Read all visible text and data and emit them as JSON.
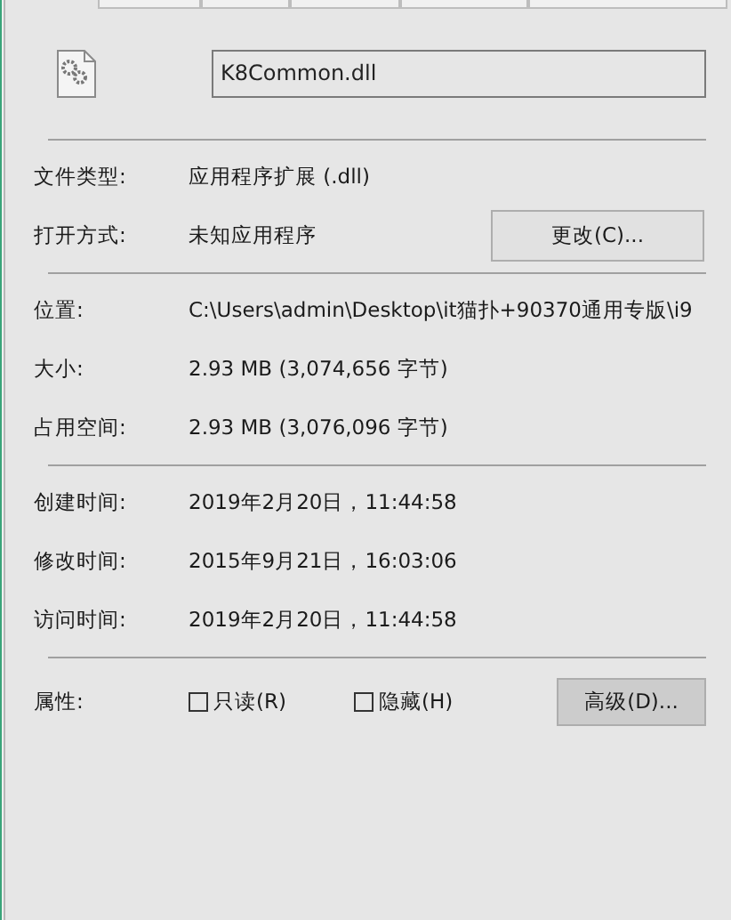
{
  "file_name": "K8Common.dll",
  "groups": [
    {
      "rows": [
        {
          "label": "文件类型:",
          "value": "应用程序扩展 (.dll)"
        },
        {
          "label": "打开方式:",
          "value": "未知应用程序",
          "button": "更改(C)..."
        }
      ]
    },
    {
      "rows": [
        {
          "label": "位置:",
          "value": "C:\\Users\\admin\\Desktop\\it猫扑+90370通用专版\\i9"
        },
        {
          "label": "大小:",
          "value": "2.93 MB (3,074,656 字节)"
        },
        {
          "label": "占用空间:",
          "value": "2.93 MB (3,076,096 字节)"
        }
      ]
    },
    {
      "rows": [
        {
          "label": "创建时间:",
          "value": "2019年2月20日，11:44:58"
        },
        {
          "label": "修改时间:",
          "value": "2015年9月21日，16:03:06"
        },
        {
          "label": "访问时间:",
          "value": "2019年2月20日，11:44:58"
        }
      ]
    }
  ],
  "attributes": {
    "label": "属性:",
    "checkboxes": [
      {
        "label": "只读(R)",
        "checked": false
      },
      {
        "label": "隐藏(H)",
        "checked": false
      }
    ],
    "button": "高级(D)..."
  }
}
